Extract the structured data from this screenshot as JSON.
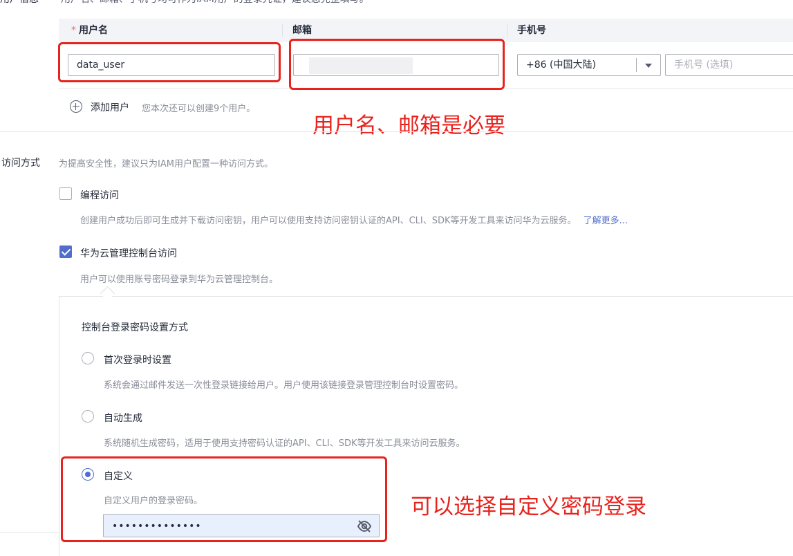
{
  "top_cutoff": {
    "label": "用户信息",
    "description": "用户名、邮箱、手机号均可作为IAM用户的登录凭证，建议您完整填写。"
  },
  "user_table": {
    "headers": {
      "username": "用户名",
      "email": "邮箱",
      "phone": "手机号"
    },
    "required_mark": "*",
    "row": {
      "username_value": "data_user",
      "email_value": "",
      "country_code": "+86 (中国大陆)",
      "phone_placeholder": "手机号 (选填)"
    },
    "add_user_label": "添加用户",
    "add_user_hint": "您本次还可以创建9个用户。"
  },
  "annotations": {
    "required_note": "用户名、邮箱是必要",
    "custom_pwd_note": "可以选择自定义密码登录",
    "color": "#e8221c"
  },
  "access": {
    "label": "访问方式",
    "hint": "为提高安全性，建议只为IAM用户配置一种访问方式。",
    "programmatic": {
      "label": "编程访问",
      "checked": false,
      "desc": "创建用户成功后即可生成并下载访问密钥，用户可以使用支持访问密钥认证的API、CLI、SDK等开发工具来访问华为云服务。",
      "learn_more": "了解更多..."
    },
    "console": {
      "label": "华为云管理控制台访问",
      "checked": true,
      "desc": "用户可以使用账号密码登录到华为云管理控制台。"
    }
  },
  "password_setting": {
    "title": "控制台登录密码设置方式",
    "options": [
      {
        "label": "首次登录时设置",
        "desc": "系统会通过邮件发送一次性登录链接给用户。用户使用该链接登录管理控制台时设置密码。",
        "selected": false
      },
      {
        "label": "自动生成",
        "desc": "系统随机生成密码，适用于使用支持密码认证的API、CLI、SDK等开发工具来访问云服务。",
        "selected": false
      },
      {
        "label": "自定义",
        "desc": "自定义用户的登录密码。",
        "selected": true
      }
    ],
    "password_value": "••••••••••••••",
    "toggle_icon": "eye-off-icon"
  },
  "colors": {
    "primary": "#526ecc",
    "header_bg": "#f3f4f7",
    "required": "#f66f6a"
  }
}
